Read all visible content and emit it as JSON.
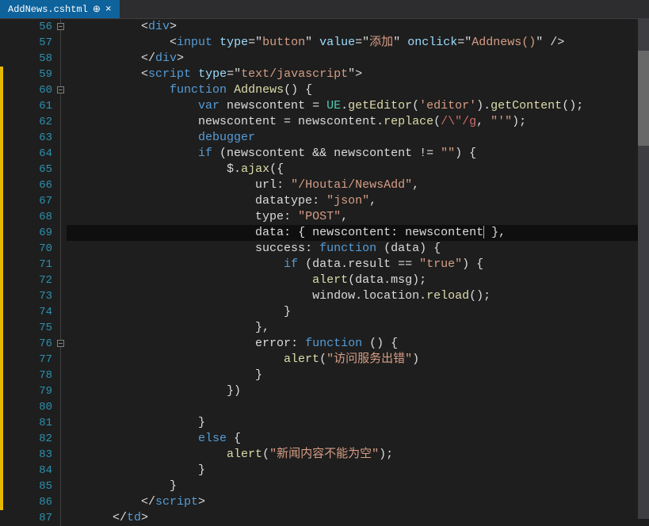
{
  "tab": {
    "filename": "AddNews.cshtml",
    "pin_glyph": "⊕",
    "close_glyph": "×"
  },
  "line_numbers": [
    "56",
    "57",
    "58",
    "59",
    "60",
    "61",
    "62",
    "63",
    "64",
    "65",
    "66",
    "67",
    "68",
    "69",
    "70",
    "71",
    "72",
    "73",
    "74",
    "75",
    "76",
    "77",
    "78",
    "79",
    "80",
    "81",
    "82",
    "83",
    "84",
    "85",
    "86",
    "87"
  ],
  "modified_lines": [
    59,
    60,
    61,
    62,
    63,
    64,
    65,
    66,
    67,
    68,
    69,
    70,
    71,
    72,
    73,
    74,
    75,
    76,
    77,
    78,
    79,
    80,
    81,
    82,
    83,
    84,
    85,
    86
  ],
  "fold_markers": {
    "56": true,
    "60": true,
    "76": true
  },
  "highlighted_line_index": 13,
  "code": {
    "l56": {
      "indent": "          ",
      "tokens": [
        {
          "t": "punc",
          "v": "<"
        },
        {
          "t": "tag",
          "v": "div"
        },
        {
          "t": "punc",
          "v": ">"
        }
      ]
    },
    "l57": {
      "indent": "              ",
      "tokens": [
        {
          "t": "punc",
          "v": "<"
        },
        {
          "t": "tag",
          "v": "input"
        },
        {
          "t": "punc",
          "v": " "
        },
        {
          "t": "attr",
          "v": "type"
        },
        {
          "t": "punc",
          "v": "=\""
        },
        {
          "t": "str",
          "v": "button"
        },
        {
          "t": "punc",
          "v": "\" "
        },
        {
          "t": "attr",
          "v": "value"
        },
        {
          "t": "punc",
          "v": "=\""
        },
        {
          "t": "str",
          "v": "添加"
        },
        {
          "t": "punc",
          "v": "\" "
        },
        {
          "t": "attr",
          "v": "onclick"
        },
        {
          "t": "punc",
          "v": "=\""
        },
        {
          "t": "str",
          "v": "Addnews()"
        },
        {
          "t": "punc",
          "v": "\" />"
        }
      ]
    },
    "l58": {
      "indent": "          ",
      "tokens": [
        {
          "t": "punc",
          "v": "</"
        },
        {
          "t": "tag",
          "v": "div"
        },
        {
          "t": "punc",
          "v": ">"
        }
      ]
    },
    "l59": {
      "indent": "          ",
      "tokens": [
        {
          "t": "punc",
          "v": "<"
        },
        {
          "t": "tag",
          "v": "script"
        },
        {
          "t": "punc",
          "v": " "
        },
        {
          "t": "attr",
          "v": "type"
        },
        {
          "t": "punc",
          "v": "=\""
        },
        {
          "t": "str",
          "v": "text/javascript"
        },
        {
          "t": "punc",
          "v": "\">"
        }
      ]
    },
    "l60": {
      "indent": "              ",
      "tokens": [
        {
          "t": "kw",
          "v": "function"
        },
        {
          "t": "punc",
          "v": " "
        },
        {
          "t": "fn",
          "v": "Addnews"
        },
        {
          "t": "punc",
          "v": "() {"
        }
      ]
    },
    "l61": {
      "indent": "                  ",
      "tokens": [
        {
          "t": "kw",
          "v": "var"
        },
        {
          "t": "punc",
          "v": " newscontent = "
        },
        {
          "t": "type",
          "v": "UE"
        },
        {
          "t": "punc",
          "v": "."
        },
        {
          "t": "fn",
          "v": "getEditor"
        },
        {
          "t": "punc",
          "v": "("
        },
        {
          "t": "str",
          "v": "'editor'"
        },
        {
          "t": "punc",
          "v": ")."
        },
        {
          "t": "fn",
          "v": "getContent"
        },
        {
          "t": "punc",
          "v": "();"
        }
      ]
    },
    "l62": {
      "indent": "                  ",
      "tokens": [
        {
          "t": "punc",
          "v": "newscontent = newscontent."
        },
        {
          "t": "fn",
          "v": "replace"
        },
        {
          "t": "punc",
          "v": "("
        },
        {
          "t": "regex",
          "v": "/\\\"/g"
        },
        {
          "t": "punc",
          "v": ", "
        },
        {
          "t": "str",
          "v": "\"'\""
        },
        {
          "t": "punc",
          "v": ");"
        }
      ]
    },
    "l63": {
      "indent": "                  ",
      "tokens": [
        {
          "t": "kw",
          "v": "debugger"
        }
      ]
    },
    "l64": {
      "indent": "                  ",
      "tokens": [
        {
          "t": "kw",
          "v": "if"
        },
        {
          "t": "punc",
          "v": " (newscontent && newscontent != "
        },
        {
          "t": "str",
          "v": "\"\""
        },
        {
          "t": "punc",
          "v": ") {"
        }
      ]
    },
    "l65": {
      "indent": "                      ",
      "tokens": [
        {
          "t": "punc",
          "v": "$."
        },
        {
          "t": "fn",
          "v": "ajax"
        },
        {
          "t": "punc",
          "v": "({"
        }
      ]
    },
    "l66": {
      "indent": "                          ",
      "tokens": [
        {
          "t": "prop",
          "v": "url"
        },
        {
          "t": "punc",
          "v": ": "
        },
        {
          "t": "str",
          "v": "\"/Houtai/NewsAdd\""
        },
        {
          "t": "punc",
          "v": ","
        }
      ]
    },
    "l67": {
      "indent": "                          ",
      "tokens": [
        {
          "t": "prop",
          "v": "datatype"
        },
        {
          "t": "punc",
          "v": ": "
        },
        {
          "t": "str",
          "v": "\"json\""
        },
        {
          "t": "punc",
          "v": ","
        }
      ]
    },
    "l68": {
      "indent": "                          ",
      "tokens": [
        {
          "t": "prop",
          "v": "type"
        },
        {
          "t": "punc",
          "v": ": "
        },
        {
          "t": "str",
          "v": "\"POST\""
        },
        {
          "t": "punc",
          "v": ","
        }
      ]
    },
    "l69": {
      "indent": "                          ",
      "tokens": [
        {
          "t": "prop",
          "v": "data"
        },
        {
          "t": "punc",
          "v": ": { "
        },
        {
          "t": "prop",
          "v": "newscontent"
        },
        {
          "t": "punc",
          "v": ": newscontent"
        },
        {
          "t": "cursor",
          "v": ""
        },
        {
          "t": "punc",
          "v": " },"
        }
      ]
    },
    "l70": {
      "indent": "                          ",
      "tokens": [
        {
          "t": "prop",
          "v": "success"
        },
        {
          "t": "punc",
          "v": ": "
        },
        {
          "t": "kw",
          "v": "function"
        },
        {
          "t": "punc",
          "v": " (data) {"
        }
      ]
    },
    "l71": {
      "indent": "                              ",
      "tokens": [
        {
          "t": "kw",
          "v": "if"
        },
        {
          "t": "punc",
          "v": " (data.result == "
        },
        {
          "t": "str",
          "v": "\"true\""
        },
        {
          "t": "punc",
          "v": ") {"
        }
      ]
    },
    "l72": {
      "indent": "                                  ",
      "tokens": [
        {
          "t": "fn",
          "v": "alert"
        },
        {
          "t": "punc",
          "v": "(data.msg);"
        }
      ]
    },
    "l73": {
      "indent": "                                  ",
      "tokens": [
        {
          "t": "punc",
          "v": "window.location."
        },
        {
          "t": "fn",
          "v": "reload"
        },
        {
          "t": "punc",
          "v": "();"
        }
      ]
    },
    "l74": {
      "indent": "                              ",
      "tokens": [
        {
          "t": "punc",
          "v": "}"
        }
      ]
    },
    "l75": {
      "indent": "                          ",
      "tokens": [
        {
          "t": "punc",
          "v": "},"
        }
      ]
    },
    "l76": {
      "indent": "                          ",
      "tokens": [
        {
          "t": "prop",
          "v": "error"
        },
        {
          "t": "punc",
          "v": ": "
        },
        {
          "t": "kw",
          "v": "function"
        },
        {
          "t": "punc",
          "v": " () {"
        }
      ]
    },
    "l77": {
      "indent": "                              ",
      "tokens": [
        {
          "t": "fn",
          "v": "alert"
        },
        {
          "t": "punc",
          "v": "("
        },
        {
          "t": "str",
          "v": "\"访问服务出错\""
        },
        {
          "t": "punc",
          "v": ")"
        }
      ]
    },
    "l78": {
      "indent": "                          ",
      "tokens": [
        {
          "t": "punc",
          "v": "}"
        }
      ]
    },
    "l79": {
      "indent": "                      ",
      "tokens": [
        {
          "t": "punc",
          "v": "})"
        }
      ]
    },
    "l80": {
      "indent": "",
      "tokens": []
    },
    "l81": {
      "indent": "                  ",
      "tokens": [
        {
          "t": "punc",
          "v": "}"
        }
      ]
    },
    "l82": {
      "indent": "                  ",
      "tokens": [
        {
          "t": "kw",
          "v": "else"
        },
        {
          "t": "punc",
          "v": " {"
        }
      ]
    },
    "l83": {
      "indent": "                      ",
      "tokens": [
        {
          "t": "fn",
          "v": "alert"
        },
        {
          "t": "punc",
          "v": "("
        },
        {
          "t": "str",
          "v": "\"新闻内容不能为空\""
        },
        {
          "t": "punc",
          "v": ");"
        }
      ]
    },
    "l84": {
      "indent": "                  ",
      "tokens": [
        {
          "t": "punc",
          "v": "}"
        }
      ]
    },
    "l85": {
      "indent": "              ",
      "tokens": [
        {
          "t": "punc",
          "v": "}"
        }
      ]
    },
    "l86": {
      "indent": "          ",
      "tokens": [
        {
          "t": "punc",
          "v": "</"
        },
        {
          "t": "tag",
          "v": "script"
        },
        {
          "t": "punc",
          "v": ">"
        }
      ]
    },
    "l87": {
      "indent": "      ",
      "tokens": [
        {
          "t": "punc",
          "v": "</"
        },
        {
          "t": "tag",
          "v": "td"
        },
        {
          "t": "punc",
          "v": ">"
        }
      ]
    }
  }
}
